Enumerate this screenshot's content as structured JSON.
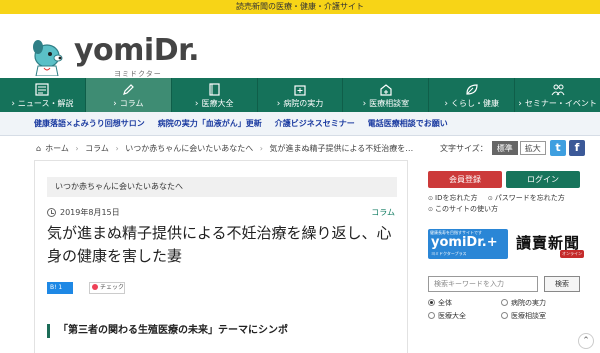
{
  "topbar": {
    "text": "読売新聞の医療・健康・介護サイト"
  },
  "logo": {
    "word": "yomiDr.",
    "kana": "ヨミドクター"
  },
  "nav": [
    {
      "label": "ニュース・解説",
      "icon": "newspaper-icon",
      "active": false
    },
    {
      "label": "コラム",
      "icon": "pen-icon",
      "active": true
    },
    {
      "label": "医療大全",
      "icon": "book-icon",
      "active": false
    },
    {
      "label": "病院の実力",
      "icon": "hospital-icon",
      "active": false
    },
    {
      "label": "医療相談室",
      "icon": "clinic-icon",
      "active": false
    },
    {
      "label": "くらし・健康",
      "icon": "leaf-icon",
      "active": false
    },
    {
      "label": "セミナー・イベント",
      "icon": "people-icon",
      "active": false
    }
  ],
  "links": [
    "健康落語×よみうり回想サロン",
    "病院の実力「血液がん」更新",
    "介護ビジネスセミナー",
    "電話医療相談でお願い"
  ],
  "breadcrumb": [
    "ホーム",
    "コラム",
    "いつか赤ちゃんに会いたいあなたへ",
    "気が進まぬ精子提供による不妊治療を…"
  ],
  "fontsize": {
    "label": "文字サイズ：",
    "standard": "標準",
    "large": "拡大"
  },
  "article": {
    "series": "いつか赤ちゃんに会いたいあなたへ",
    "date": "2019年8月15日",
    "category": "コラム",
    "title": "気が進まぬ精子提供による不妊治療を繰り返し、心身の健康を害した妻",
    "hatena": "B! 1",
    "pocket": "チェック",
    "h2": "「第三者の関わる生殖医療の未来」テーマにシンポ"
  },
  "sidebar": {
    "register": "会員登録",
    "login": "ログイン",
    "help": [
      "IDを忘れた方",
      "パスワードを忘れた方",
      "このサイトの使い方"
    ],
    "promo_top": "健康長寿を目指すサイトです",
    "promo_main": "yomiDr.+",
    "promo_sub": "ヨミドクタープラス",
    "newspaper": "讀賣新聞",
    "online": "オンライン",
    "search_placeholder": "検索キーワードを入力",
    "search_button": "検索",
    "scopes": [
      {
        "label": "全体",
        "checked": true
      },
      {
        "label": "病院の実力",
        "checked": false
      },
      {
        "label": "医療大全",
        "checked": false
      },
      {
        "label": "医療相談室",
        "checked": false
      }
    ]
  },
  "colors": {
    "nav_green": "#15725a",
    "top_yellow": "#f7d417",
    "register_red": "#cc3a3a",
    "login_green": "#17745b"
  }
}
